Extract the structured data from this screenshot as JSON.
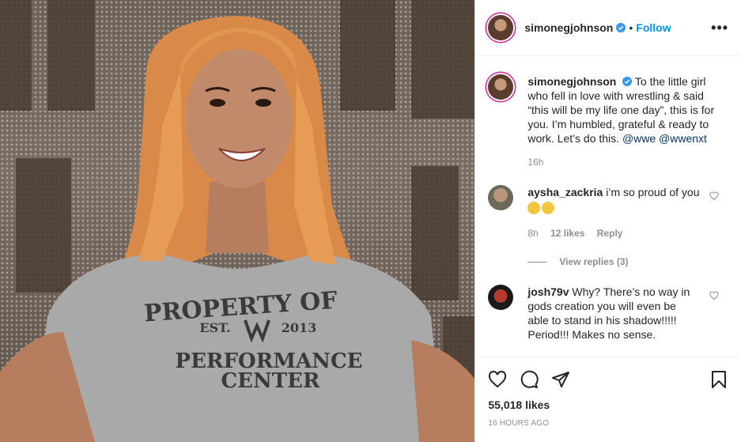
{
  "header": {
    "username": "simonegjohnson",
    "separator": "•",
    "follow_label": "Follow",
    "more_label": "•••"
  },
  "photo": {
    "shirt_line1": "PROPERTY OF",
    "shirt_est": "EST.",
    "shirt_year": "2013",
    "shirt_line3": "PERFORMANCE",
    "shirt_line4": "CENTER"
  },
  "caption": {
    "username": "simonegjohnson",
    "text": "To the little girl who fell in love with wrestling & said “this will be my life one day”, this is for you. I’m humbled, grateful & ready to work. Let’s do this.",
    "mention1": "@wwe",
    "mention2": "@wwenxt",
    "time": "16h"
  },
  "comments": [
    {
      "username": "aysha_zackria",
      "text": "i’m so proud of you",
      "time": "8h",
      "likes": "12 likes",
      "reply_label": "Reply",
      "view_replies": "View replies (3)"
    },
    {
      "username": "josh79v",
      "text": "Why? There’s no way in gods creation you will even be able to stand in his shadow!!!!! Period!!! Makes no sense."
    }
  ],
  "footer": {
    "likes": "55,018 likes",
    "timestamp": "16 HOURS AGO"
  },
  "colors": {
    "accent": "#0095f6",
    "mention": "#00376b",
    "muted": "#8e8e8e",
    "verified": "#3897f0"
  },
  "icons": [
    "verified-icon",
    "more-icon",
    "heart-icon",
    "comment-icon",
    "share-icon",
    "bookmark-icon"
  ]
}
